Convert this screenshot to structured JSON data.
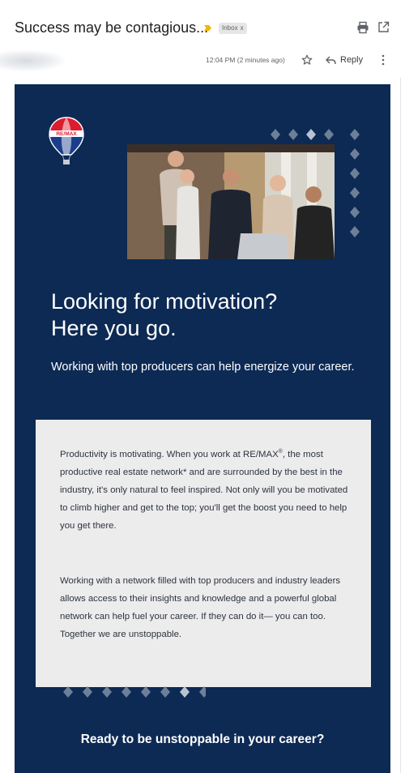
{
  "email": {
    "subject": "Success may be contagious...",
    "label": "Inbox",
    "label_close": "x",
    "timestamp": "12:04 PM (2 minutes ago)",
    "reply_label": "Reply"
  },
  "icons": {
    "important": "important-marker-icon",
    "print": "print-icon",
    "popout": "open-in-new-window-icon",
    "star": "star-icon",
    "reply": "reply-arrow-icon",
    "more": "more-vert-icon",
    "logo": "hot-air-balloon-logo",
    "logo_text": "RE/MAX"
  },
  "colors": {
    "brand_navy": "#0c2a54",
    "panel_gray": "#ececec",
    "diamond": "#6e7f98",
    "important_yellow": "#f4b400"
  },
  "content": {
    "headline_line1": "Looking for motivation?",
    "headline_line2": "Here you go.",
    "subline": "Working with top producers can help energize your career.",
    "para1_before": "Productivity is motivating. When you work at RE/MAX",
    "para1_reg": "®",
    "para1_after": ", the most productive real estate network* and are surrounded by the best in the industry, it's only natural to feel inspired. Not only will you be motivated to climb higher and get to the top; you'll get the boost you need to help you get there.",
    "para2": "Working with a network filled with top producers and industry leaders allows access to their insights and knowledge and a powerful global network can help fuel your career. If they can do it— you can too. Together we are unstoppable.",
    "cta_heading": "Ready to be unstoppable in your career?"
  }
}
